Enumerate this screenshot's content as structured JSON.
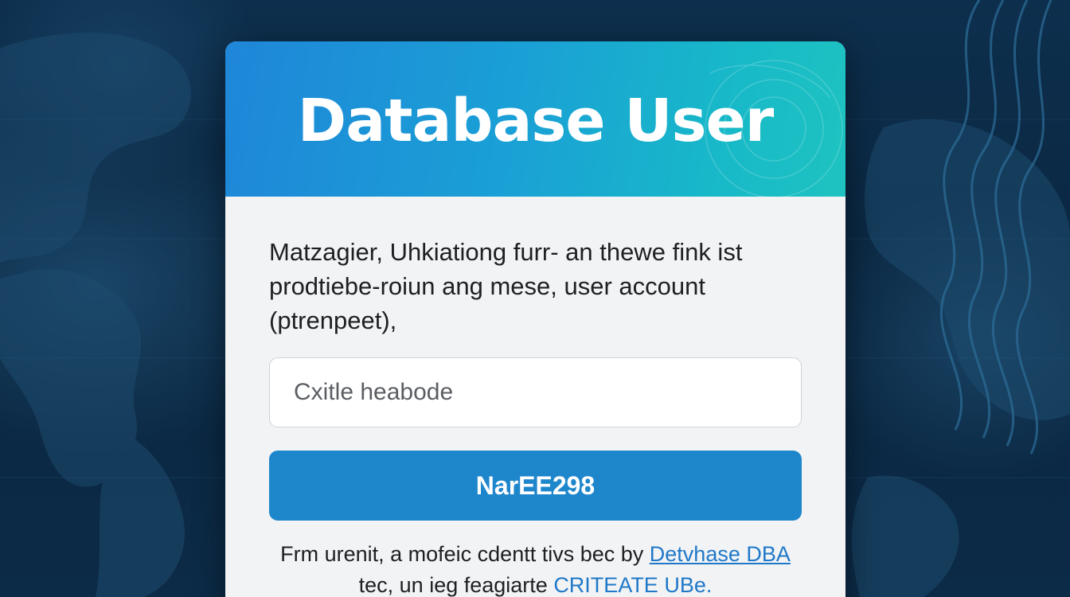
{
  "card": {
    "title": "Database User",
    "description": "Matzagier, Uhkiationg furr- an thewe fink ist prodtiebe-roiun ang mese, user account (ptrenpeet),",
    "input": {
      "placeholder": "Cxitle heabode",
      "value": ""
    },
    "button_label": "NarEE298",
    "footer": {
      "line1_text": "Frm urenit, a mofeic cdentt tivs bec by ",
      "line1_link": "Detvhase DBA",
      "line2_text": "tec, un ieg feagiarte ",
      "line2_link": "CRITEATE UBe."
    }
  },
  "colors": {
    "header_gradient_start": "#1f86d8",
    "header_gradient_end": "#1ec3c0",
    "button": "#1e87cc",
    "link": "#1f78c8",
    "background": "#0b2a45"
  }
}
